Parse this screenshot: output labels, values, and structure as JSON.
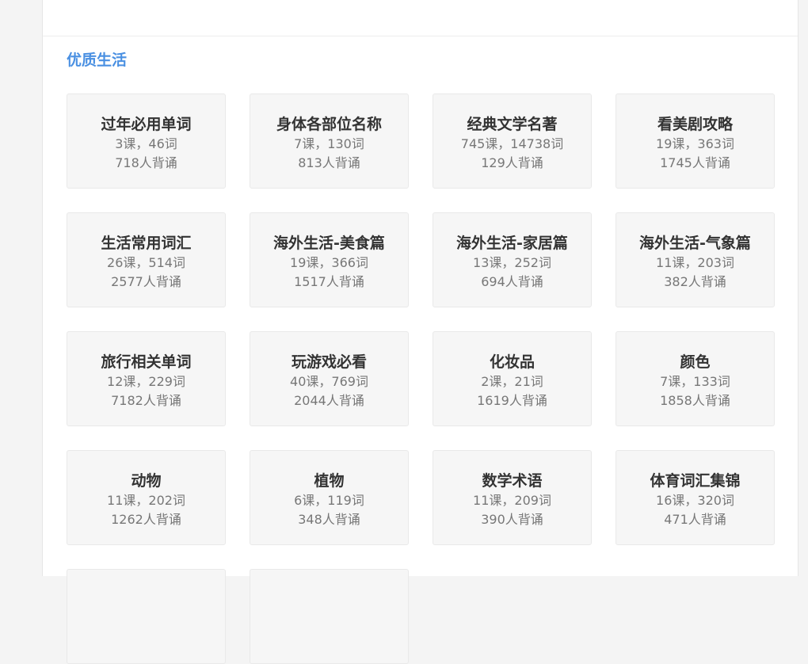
{
  "section": {
    "title": "优质生活"
  },
  "cards": [
    {
      "title": "过年必用单词",
      "stats": "3课，46词",
      "learners": "718人背诵"
    },
    {
      "title": "身体各部位名称",
      "stats": "7课，130词",
      "learners": "813人背诵"
    },
    {
      "title": "经典文学名著",
      "stats": "745课，14738词",
      "learners": "129人背诵"
    },
    {
      "title": "看美剧攻略",
      "stats": "19课，363词",
      "learners": "1745人背诵"
    },
    {
      "title": "生活常用词汇",
      "stats": "26课，514词",
      "learners": "2577人背诵"
    },
    {
      "title": "海外生活-美食篇",
      "stats": "19课，366词",
      "learners": "1517人背诵"
    },
    {
      "title": "海外生活-家居篇",
      "stats": "13课，252词",
      "learners": "694人背诵"
    },
    {
      "title": "海外生活-气象篇",
      "stats": "11课，203词",
      "learners": "382人背诵"
    },
    {
      "title": "旅行相关单词",
      "stats": "12课，229词",
      "learners": "7182人背诵"
    },
    {
      "title": "玩游戏必看",
      "stats": "40课，769词",
      "learners": "2044人背诵"
    },
    {
      "title": "化妆品",
      "stats": "2课，21词",
      "learners": "1619人背诵"
    },
    {
      "title": "颜色",
      "stats": "7课，133词",
      "learners": "1858人背诵"
    },
    {
      "title": "动物",
      "stats": "11课，202词",
      "learners": "1262人背诵"
    },
    {
      "title": "植物",
      "stats": "6课，119词",
      "learners": "348人背诵"
    },
    {
      "title": "数学术语",
      "stats": "11课，209词",
      "learners": "390人背诵"
    },
    {
      "title": "体育词汇集锦",
      "stats": "16课，320词",
      "learners": "471人背诵"
    },
    {
      "title": "",
      "stats": "",
      "learners": ""
    },
    {
      "title": "",
      "stats": "",
      "learners": ""
    }
  ],
  "colors": {
    "accent": "#4a90e2",
    "card_background": "#f6f6f6",
    "page_background": "#f4f4f4"
  }
}
